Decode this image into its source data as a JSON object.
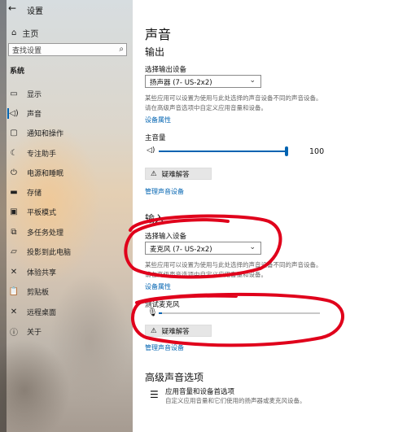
{
  "window": {
    "app_name": "设置",
    "back_glyph": "←"
  },
  "sidebar": {
    "home_label": "主页",
    "search_placeholder": "查找设置",
    "section_label": "系统",
    "items": [
      {
        "label": "显示",
        "icon": "monitor-icon",
        "glyph": "▭"
      },
      {
        "label": "声音",
        "icon": "speaker-icon",
        "glyph": "◁)"
      },
      {
        "label": "通知和操作",
        "icon": "notification-icon",
        "glyph": "▢"
      },
      {
        "label": "专注助手",
        "icon": "moon-icon",
        "glyph": "☾"
      },
      {
        "label": "电源和睡眠",
        "icon": "power-icon",
        "glyph": "⏻"
      },
      {
        "label": "存储",
        "icon": "storage-icon",
        "glyph": "▬"
      },
      {
        "label": "平板模式",
        "icon": "tablet-icon",
        "glyph": "▣"
      },
      {
        "label": "多任务处理",
        "icon": "multitask-icon",
        "glyph": "⧉"
      },
      {
        "label": "投影到此电脑",
        "icon": "project-icon",
        "glyph": "▱"
      },
      {
        "label": "体验共享",
        "icon": "share-icon",
        "glyph": "✕"
      },
      {
        "label": "剪贴板",
        "icon": "clipboard-icon",
        "glyph": "📋"
      },
      {
        "label": "远程桌面",
        "icon": "remote-icon",
        "glyph": "✕"
      },
      {
        "label": "关于",
        "icon": "info-icon",
        "glyph": "ⓘ"
      }
    ]
  },
  "main": {
    "title": "声音",
    "output": {
      "heading": "输出",
      "device_label": "选择输出设备",
      "device_value": "扬声器 (7- US-2x2)",
      "description": "某些应用可以设置为使用与此处选择的声音设备不同的声音设备。请在高级声音选项中自定义应用音量和设备。",
      "device_properties": "设备属性",
      "master_volume_label": "主音量",
      "master_volume_value": "100",
      "troubleshoot": "疑难解答",
      "manage_devices": "管理声音设备"
    },
    "input": {
      "heading": "输入",
      "device_label": "选择输入设备",
      "device_value": "麦克风 (7- US-2x2)",
      "description": "某些应用可以设置为使用与此处选择的声音设备不同的声音设备。请在高级声音选项中自定义应用音量和设备。",
      "device_properties": "设备属性",
      "test_mic_label": "测试麦克风",
      "troubleshoot": "疑难解答",
      "manage_devices": "管理声音设备"
    },
    "advanced": {
      "heading": "高级声音选项",
      "app_volume_title": "应用音量和设备首选项",
      "app_volume_desc": "自定义应用音量和它们使用的扬声器或麦克风设备。"
    }
  },
  "colors": {
    "accent": "#0063b1",
    "annotation": "#e0001b"
  }
}
